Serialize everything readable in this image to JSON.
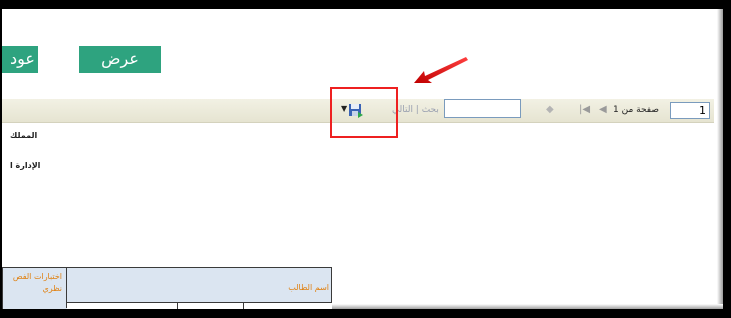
{
  "buttons": {
    "view_label": "عرض",
    "back_label": "عود"
  },
  "toolbar": {
    "page_number": "1",
    "page_of_label": "صفحة من 1",
    "nav_first_icon": "first-page-icon",
    "nav_prev_icon": "prev-page-icon",
    "nav_next_icon": "next-page-icon",
    "search_value": "",
    "find_label": "بحث | التالي",
    "export_icon": "save-export-icon"
  },
  "report": {
    "header_line1": "المملك",
    "header_line2": "الإدارة ا",
    "table": {
      "exam_header": "اختبارات الفص\nنظري",
      "student_name_header": "اسم الطالب"
    }
  },
  "colors": {
    "button_green": "#2ea37f",
    "highlight_red": "#ee2020",
    "header_orange": "#e08010",
    "table_bg": "#dbe5f1"
  }
}
